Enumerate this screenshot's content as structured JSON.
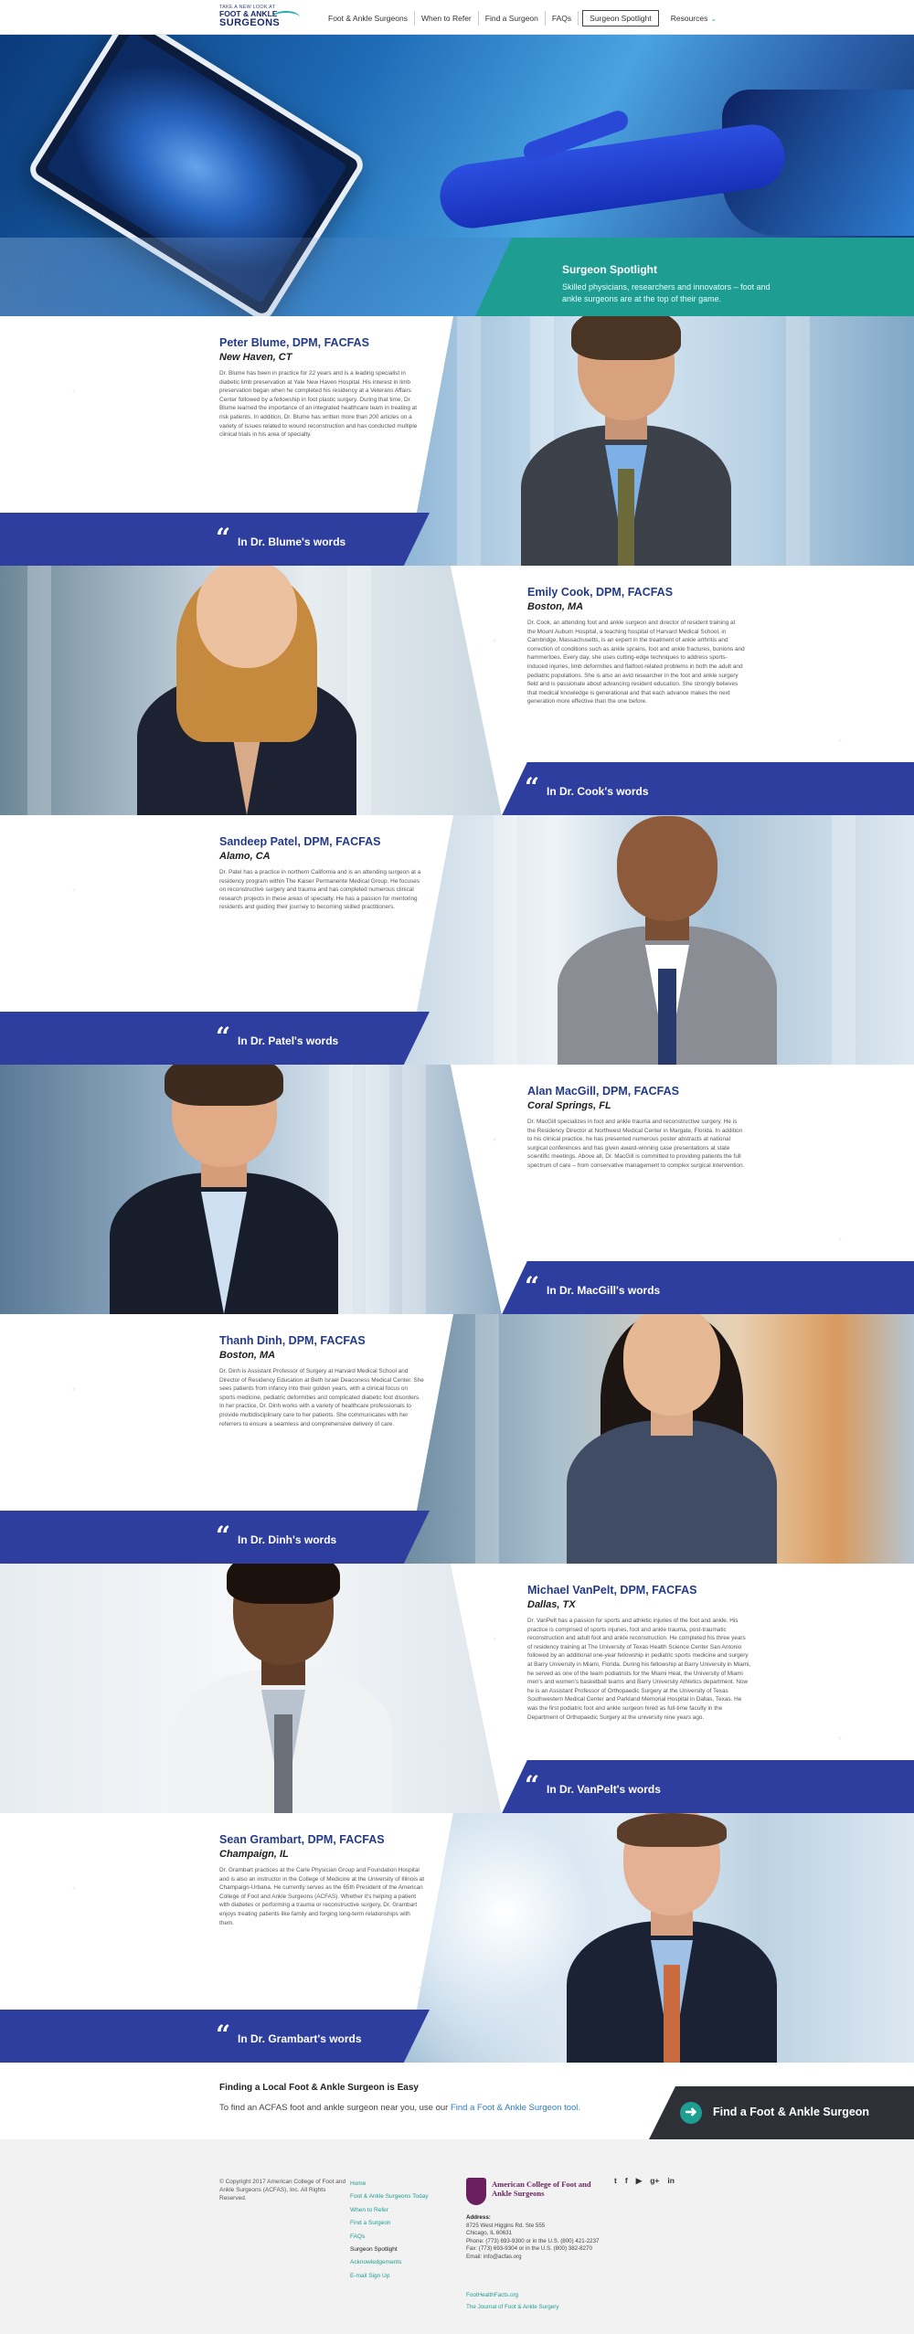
{
  "nav": {
    "logo_tagline": "TAKE A NEW LOOK AT",
    "logo_line1": "FOOT & ANKLE",
    "logo_line2": "SURGEONS",
    "items": [
      {
        "label": "Foot & Ankle Surgeons"
      },
      {
        "label": "When to Refer"
      },
      {
        "label": "Find a Surgeon"
      },
      {
        "label": "FAQs"
      },
      {
        "label": "Surgeon Spotlight"
      },
      {
        "label": "Resources"
      }
    ]
  },
  "hero": {
    "title": "Surgeon Spotlight",
    "subtitle": "Skilled physicians, researchers and innovators – foot and ankle surgeons are at the top of their game."
  },
  "profiles": [
    {
      "name": "Peter Blume, DPM, FACFAS",
      "location": "New Haven, CT",
      "bio": "Dr. Blume has been in practice for 22 years and is a leading specialist in diabetic limb preservation at Yale New Haven Hospital. His interest in limb preservation began when he completed his residency at a Veterans Affairs Center followed by a fellowship in foot plastic surgery. During that time, Dr. Blume learned the importance of an integrated healthcare team in treating at risk patients. In addition, Dr. Blume has written more than 200 articles on a variety of issues related to wound reconstruction and has conducted multiple clinical trials in his area of specialty.",
      "quote": "In Dr. Blume's words"
    },
    {
      "name": "Emily Cook, DPM, FACFAS",
      "location": "Boston, MA",
      "bio": "Dr. Cook, an attending foot and ankle surgeon and director of resident training at the Mount Auburn Hospital, a teaching hospital of Harvard Medical School, in Cambridge, Massachusetts, is an expert in the treatment of ankle arthritis and correction of conditions such as ankle sprains, foot and ankle fractures, bunions and hammertoes. Every day, she uses cutting-edge techniques to address sports-induced injuries, limb deformities and flatfoot-related problems in both the adult and pediatric populations. She is also an avid researcher in the foot and ankle surgery field and is passionate about advancing resident education. She strongly believes that medical knowledge is generational and that each advance makes the next generation more effective than the one before.",
      "quote": "In Dr. Cook's words"
    },
    {
      "name": "Sandeep Patel, DPM, FACFAS",
      "location": "Alamo, CA",
      "bio": "Dr. Patel has a practice in northern California and is an attending surgeon at a residency program within The Kaiser Permanente Medical Group. He focuses on reconstructive surgery and trauma and has completed numerous clinical research projects in these areas of specialty. He has a passion for mentoring residents and guiding their journey to becoming skilled practitioners.",
      "quote": "In Dr. Patel's words"
    },
    {
      "name": "Alan MacGill, DPM, FACFAS",
      "location": "Coral Springs, FL",
      "bio": "Dr. MacGill specializes in foot and ankle trauma and reconstructive surgery. He is the Residency Director at Northwest Medical Center in Margate, Florida. In addition to his clinical practice, he has presented numerous poster abstracts at national surgical conferences and has given award-winning case presentations at state scientific meetings. Above all, Dr. MacGill is committed to providing patients the full spectrum of care – from conservative management to complex surgical intervention.",
      "quote": "In Dr. MacGill's words"
    },
    {
      "name": "Thanh Dinh, DPM, FACFAS",
      "location": "Boston, MA",
      "bio": "Dr. Dinh is Assistant Professor of Surgery at Harvard Medical School and Director of Residency Education at Beth Israel Deaconess Medical Center. She sees patients from infancy into their golden years, with a clinical focus on sports medicine, pediatric deformities and complicated diabetic foot disorders. In her practice, Dr. Dinh works with a variety of healthcare professionals to provide multidisciplinary care to her patients. She communicates with her referrers to ensure a seamless and comprehensive delivery of care.",
      "quote": "In Dr. Dinh's words"
    },
    {
      "name": "Michael VanPelt, DPM, FACFAS",
      "location": "Dallas, TX",
      "bio": "Dr. VanPelt has a passion for sports and athletic injuries of the foot and ankle. His practice is comprised of sports injuries, foot and ankle trauma, post-traumatic reconstruction and adult foot and ankle reconstruction. He completed his three years of residency training at The University of Texas Health Science Center San Antonio followed by an additional one-year fellowship in pediatric sports medicine and surgery at Barry University in Miami, Florida. During his fellowship at Barry University in Miami, he served as one of the team podiatrists for the Miami Heat, the University of Miami men's and women's basketball teams and Barry University Athletics department. Now he is an Assistant Professor of Orthopaedic Surgery at the University of Texas Southwestern Medical Center and Parkland Memorial Hospital in Dallas, Texas. He was the first podiatric foot and ankle surgeon hired as full-time faculty in the Department of Orthopaedic Surgery at the university nine years ago.",
      "quote": "In Dr. VanPelt's words"
    },
    {
      "name": "Sean Grambart, DPM, FACFAS",
      "location": "Champaign, IL",
      "bio": "Dr. Grambart practices at the Carle Physician Group and Foundation Hospital and is also an instructor in the College of Medicine at the University of Illinois at Champaign-Urbana. He currently serves as the 65th President of the American College of Foot and Ankle Surgeons (ACFAS). Whether it's helping a patient with diabetes or performing a trauma or reconstructive surgery, Dr. Grambart enjoys treating patients like family and forging long-term relationships with them.",
      "quote": "In Dr. Grambart's words"
    }
  ],
  "find": {
    "title": "Finding a Local Foot & Ankle Surgeon is Easy",
    "text": "To find an ACFAS foot and ankle surgeon near you, use our",
    "link": "Find a Foot & Ankle Surgeon tool.",
    "button": "Find a Foot & Ankle Surgeon"
  },
  "footer": {
    "copyright": "© Copyright 2017 American College of Foot and Ankle Surgeons (ACFAS), Inc. All Rights Reserved.",
    "links": [
      "Home",
      "Foot & Ankle Surgeons Today",
      "When to Refer",
      "Find a Surgeon",
      "FAQs",
      "Surgeon Spotlight",
      "Acknowledgements",
      "E-mail Sign Up"
    ],
    "org_name": "American College of Foot and Ankle Surgeons",
    "address_label": "Address:",
    "address_line1": "8725 West Higgins Rd. Ste 555",
    "address_line2": "Chicago, IL 60631",
    "phone": "Phone: (773) 693-9300 or in the U.S. (800) 421-2237",
    "fax": "Fax: (773) 693-9304 or in the U.S. (800) 382-8270",
    "email": "Email: info@acfas.org",
    "extra_links": [
      "FootHealthFacts.org",
      "The Journal of Foot & Ankle Surgery"
    ],
    "social": [
      "twitter-icon",
      "facebook-icon",
      "youtube-icon",
      "googleplus-icon",
      "linkedin-icon"
    ],
    "social_glyphs": [
      "t",
      "f",
      "▶",
      "g+",
      "in"
    ]
  },
  "colors": {
    "navy_band": "#2e3e9e",
    "teal": "#1e9d92",
    "name_blue": "#233a8b",
    "dark_button": "#2d3136"
  }
}
